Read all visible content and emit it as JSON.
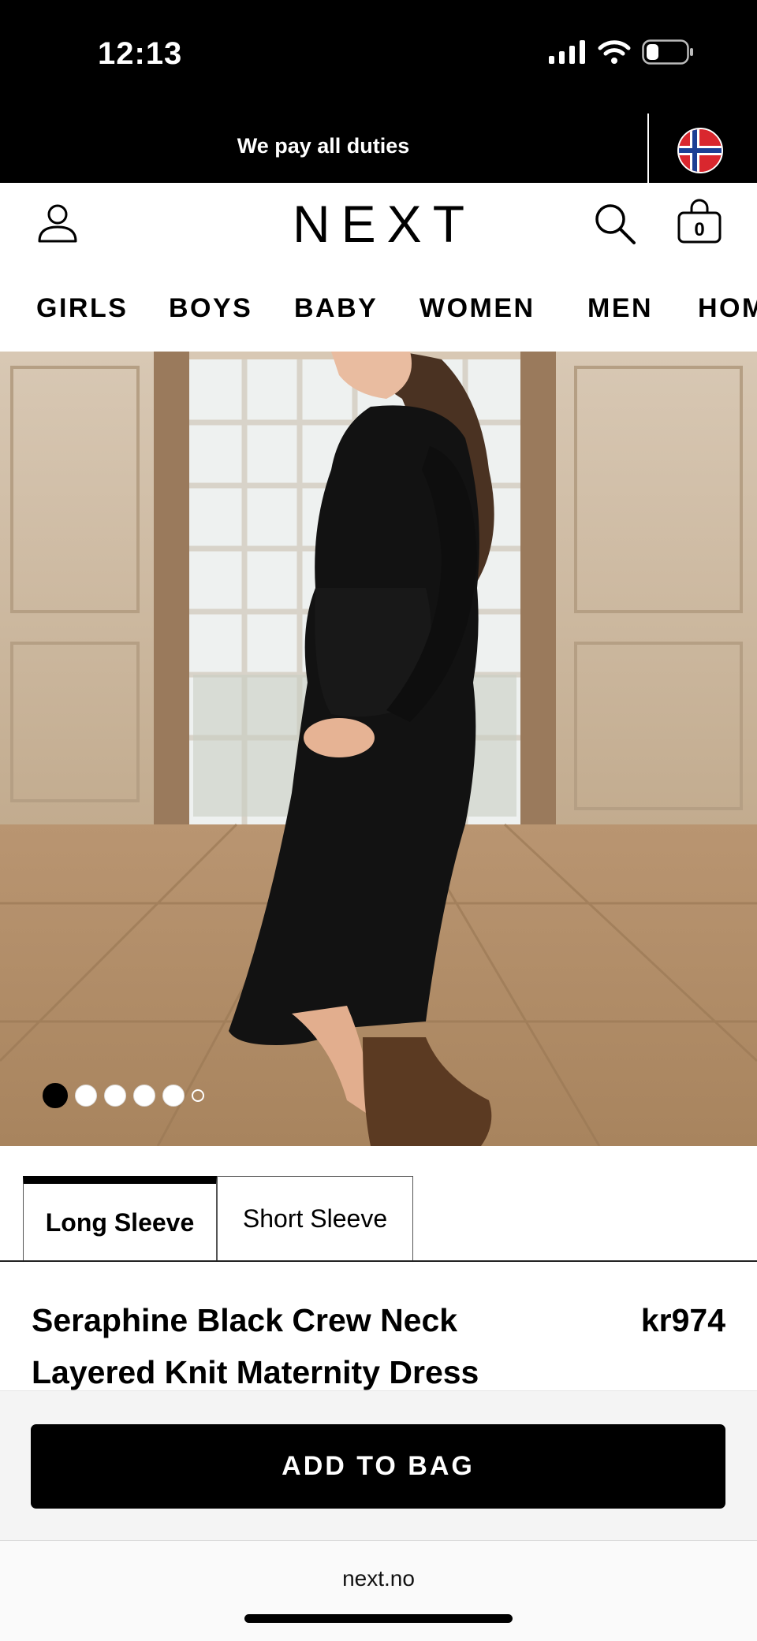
{
  "status_bar": {
    "time": "12:13"
  },
  "promo": {
    "text": "We pay all duties",
    "flag": "norway-flag"
  },
  "header": {
    "logo": "NEXT",
    "bag_count": "0"
  },
  "nav": {
    "items": [
      "GIRLS",
      "BOYS",
      "BABY",
      "WOMEN",
      "MEN",
      "HOME"
    ]
  },
  "gallery": {
    "image_count": 6,
    "active_index": 0
  },
  "variant_tabs": {
    "items": [
      "Long Sleeve",
      "Short Sleeve"
    ],
    "active": "Long Sleeve"
  },
  "product": {
    "title": "Seraphine Black Crew Neck Layered Knit Maternity Dress",
    "price": "kr974"
  },
  "cta": {
    "add_to_bag": "ADD TO BAG"
  },
  "browser": {
    "url": "next.no"
  }
}
